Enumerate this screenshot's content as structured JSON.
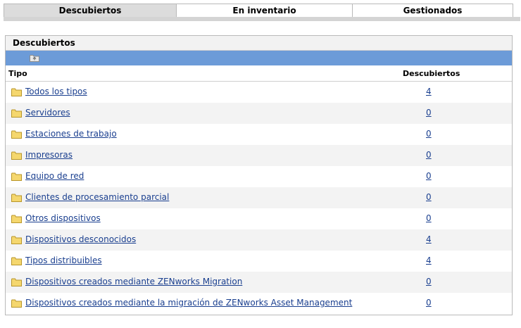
{
  "tabs": [
    {
      "label": "Descubiertos",
      "active": true
    },
    {
      "label": "En inventario",
      "active": false
    },
    {
      "label": "Gestionados",
      "active": false
    }
  ],
  "panel": {
    "title": "Descubiertos",
    "toolbar": {
      "icon": "up-folder-icon"
    },
    "columns": {
      "tipo": "Tipo",
      "descubiertos": "Descubiertos"
    },
    "rows": [
      {
        "name": "Todos los tipos",
        "count": "4"
      },
      {
        "name": "Servidores",
        "count": "0"
      },
      {
        "name": "Estaciones de trabajo",
        "count": "0"
      },
      {
        "name": "Impresoras",
        "count": "0"
      },
      {
        "name": "Equipo de red",
        "count": "0"
      },
      {
        "name": "Clientes de procesamiento parcial",
        "count": "0"
      },
      {
        "name": "Otros dispositivos",
        "count": "0"
      },
      {
        "name": "Dispositivos desconocidos",
        "count": "4"
      },
      {
        "name": "Tipos distribuibles",
        "count": "4"
      },
      {
        "name": "Dispositivos creados mediante ZENworks Migration",
        "count": "0"
      },
      {
        "name": "Dispositivos creados mediante la migración de ZENworks Asset Management",
        "count": "0"
      }
    ]
  },
  "colors": {
    "toolbar": "#6c9bd8",
    "link": "#1a3f8f",
    "active_tab": "#dcdcdc",
    "folder": "#f5d76e"
  }
}
